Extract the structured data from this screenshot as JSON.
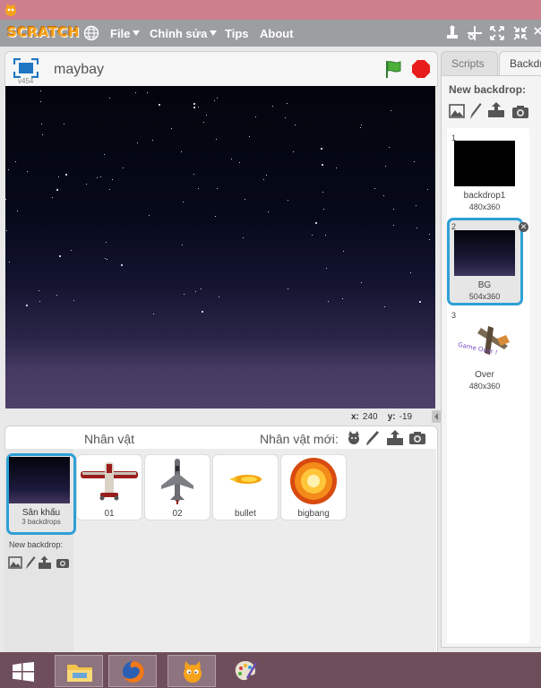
{
  "menubar": {
    "logo": "SCRATCH",
    "items": [
      {
        "label": "File",
        "dropdown": true
      },
      {
        "label": "Chỉnh sửa",
        "dropdown": true
      },
      {
        "label": "Tips",
        "dropdown": false
      },
      {
        "label": "About",
        "dropdown": false
      }
    ],
    "tools": [
      "duplicate-stamp-icon",
      "cut-icon",
      "grow-icon",
      "shrink-icon",
      "help-icon"
    ]
  },
  "stage": {
    "name": "maybay",
    "version": "v454",
    "coords": {
      "x_label": "x:",
      "x_value": "240",
      "y_label": "y:",
      "y_value": "-19"
    }
  },
  "sprites": {
    "title": "Nhân vật",
    "new_label": "Nhân vật mới:",
    "items": [
      {
        "name": "01"
      },
      {
        "name": "02"
      },
      {
        "name": "bullet"
      },
      {
        "name": "bigbang"
      }
    ],
    "stage_tile": {
      "label": "Sân khấu",
      "sub": "3 backdrops"
    },
    "new_backdrop_label": "New backdrop:"
  },
  "tabs": {
    "scripts": "Scripts",
    "backdrops": "Backdrops"
  },
  "backdrops": {
    "new_label": "New backdrop:",
    "items": [
      {
        "num": "1",
        "name": "backdrop1",
        "size": "480x360"
      },
      {
        "num": "2",
        "name": "BG",
        "size": "504x360",
        "selected": true
      },
      {
        "num": "3",
        "name": "Over",
        "size": "480x360",
        "thumb_text": "Game Over !"
      }
    ]
  },
  "colors": {
    "accent": "#2ea0d6",
    "menubar": "#9c9ea2",
    "titlebar": "#cd7f8e",
    "taskbar": "#6f4e5c"
  }
}
